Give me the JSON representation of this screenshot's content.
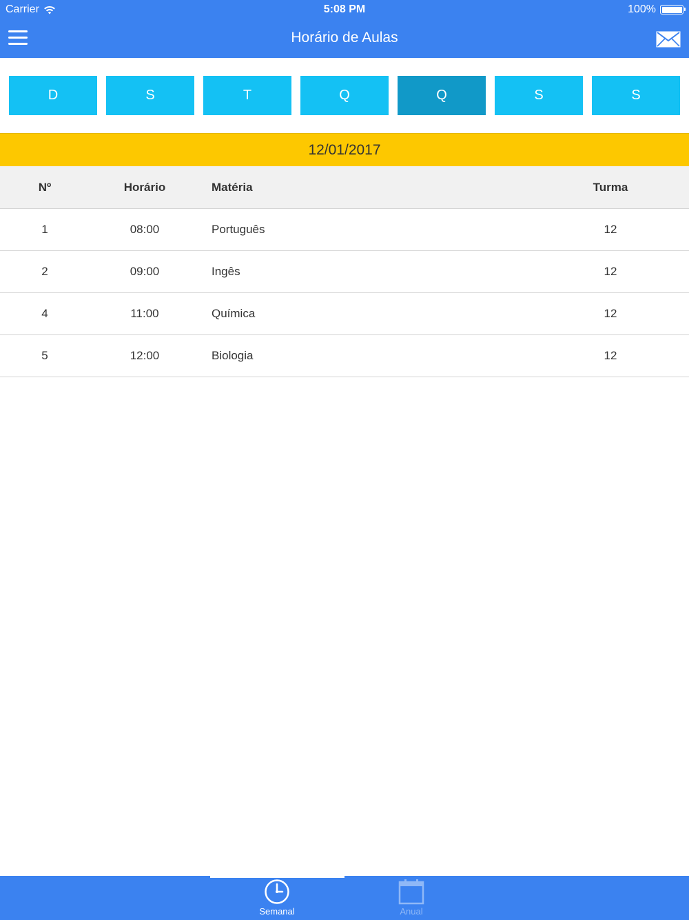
{
  "status_bar": {
    "carrier": "Carrier",
    "time": "5:08 PM",
    "battery": "100%"
  },
  "nav": {
    "title": "Horário de Aulas",
    "menu_icon": "hamburger-menu-icon",
    "mail_icon": "envelope-icon"
  },
  "days": [
    {
      "label": "D",
      "active": false
    },
    {
      "label": "S",
      "active": false
    },
    {
      "label": "T",
      "active": false
    },
    {
      "label": "Q",
      "active": false
    },
    {
      "label": "Q",
      "active": true
    },
    {
      "label": "S",
      "active": false
    },
    {
      "label": "S",
      "active": false
    }
  ],
  "date": "12/01/2017",
  "table": {
    "headers": {
      "no": "Nº",
      "horario": "Horário",
      "materia": "Matéria",
      "turma": "Turma"
    },
    "rows": [
      {
        "no": "1",
        "horario": "08:00",
        "materia": "Português",
        "turma": "12"
      },
      {
        "no": "2",
        "horario": "09:00",
        "materia": "Ingês",
        "turma": "12"
      },
      {
        "no": "4",
        "horario": "11:00",
        "materia": "Química",
        "turma": "12"
      },
      {
        "no": "5",
        "horario": "12:00",
        "materia": "Biologia",
        "turma": "12"
      }
    ]
  },
  "tabs": [
    {
      "label": "Semanal",
      "icon": "clock-icon",
      "active": true
    },
    {
      "label": "Anual",
      "icon": "calendar-icon",
      "active": false
    }
  ],
  "colors": {
    "primary": "#3b82f0",
    "day_button": "#14c1f4",
    "day_button_active": "#1199c8",
    "date_banner": "#fdc800",
    "table_header": "#f1f1f1"
  }
}
